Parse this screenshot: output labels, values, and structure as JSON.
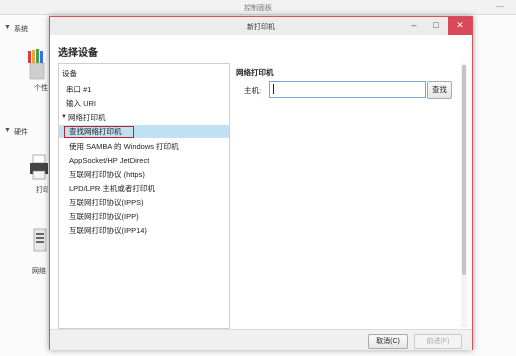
{
  "background_window": {
    "title": "控制面板",
    "section_system": "系统",
    "item_personal": "个性",
    "section_hardware": "硬件",
    "item_printer": "打印",
    "item_network": "网络"
  },
  "dialog": {
    "title": "新打印机",
    "heading": "选择设备",
    "tree": [
      {
        "label": "设备"
      },
      {
        "label": "串口 #1"
      },
      {
        "label": "输入 URI"
      },
      {
        "label": "网络打印机"
      },
      {
        "label": "查找网络打印机"
      },
      {
        "label": "使用 SAMBA 的 Windows 打印机"
      },
      {
        "label": "AppSocket/HP JetDirect"
      },
      {
        "label": "互联网打印协议 (https)"
      },
      {
        "label": "LPD/LPR 主机或者打印机"
      },
      {
        "label": "互联网打印协议(IPPS)"
      },
      {
        "label": "互联网打印协议(IPP)"
      },
      {
        "label": "互联网打印协议(IPP14)"
      }
    ],
    "right": {
      "section_title": "网络打印机",
      "host_label": "主机:",
      "host_value": "",
      "find_label": "查找"
    },
    "footer": {
      "cancel_label": "取消(C)",
      "forward_label": "前进(F)"
    }
  },
  "colors": {
    "selection": "#bfe2f3",
    "highlight_border": "#c0202a",
    "close_button": "#d94a58"
  }
}
